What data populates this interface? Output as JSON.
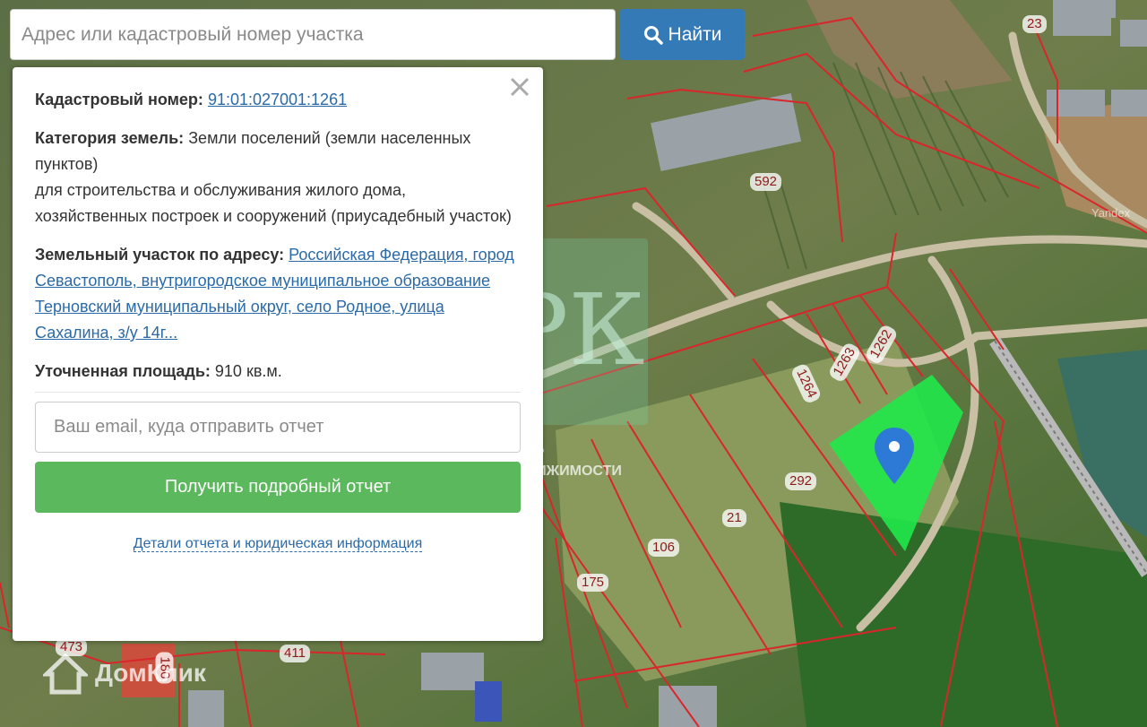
{
  "search": {
    "placeholder": "Адрес или кадастровый номер участка",
    "button_label": "Найти"
  },
  "card": {
    "cadastral_label": "Кадастровый номер:",
    "cadastral_value": "91:01:027001:1261",
    "category_label": "Категория земель:",
    "category_value": "Земли поселений (земли населенных пунктов)",
    "category_purpose": "для строительства и обслуживания жилого дома, хозяйственных построек и сооружений (приусадебный участок)",
    "address_label": "Земельный участок по адресу:",
    "address_value": "Российская Федерация, город Севастополь, внутригородское муниципальное образование Терновский муниципальный округ, село Родное, улица Сахалина, з/у 14г...",
    "area_label": "Уточненная площадь:",
    "area_value": "910 кв.м.",
    "email_placeholder": "Ваш email, куда отправить отчет",
    "report_button": "Получить подробный отчет",
    "details_link": "Детали отчета и юридическая информация"
  },
  "map": {
    "plot_labels": [
      "23",
      "592",
      "1262",
      "1263",
      "1264",
      "292",
      "21",
      "106",
      "175",
      "411",
      "473",
      "180"
    ],
    "yandex_attribution": "Yandex",
    "watermark_logo": "РК",
    "watermark_text": "ЦЕНТР НЕДВИЖИМОСТИ",
    "domclick_logo": "ДомКлик"
  },
  "colors": {
    "accent_blue": "#337ab7",
    "success_green": "#5cb85c",
    "highlight_plot": "#22e64a",
    "boundary": "#d9262b"
  }
}
